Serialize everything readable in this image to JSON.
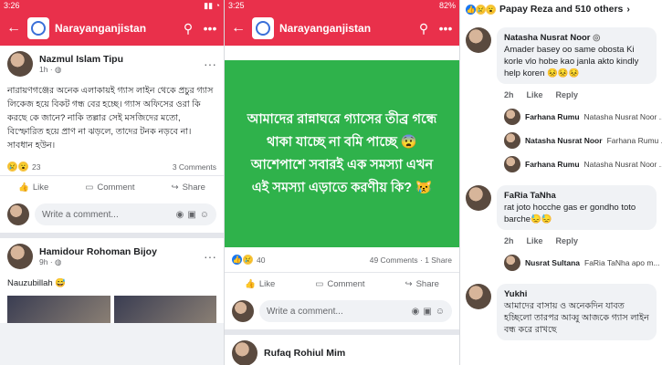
{
  "panel1": {
    "status": {
      "time": "3:26",
      "right": ""
    },
    "appbar": {
      "page_name": "Narayanganjistan"
    },
    "post1": {
      "author": "Nazmul Islam Tipu",
      "time": "1h ·",
      "text": "নারায়ণগঞ্জের অনেক এলাকায়ই গ্যাস লাইন থেকে প্রচুর গ্যাস লিকেজ হয়ে বিকট গন্ধ বের হচ্ছে। গ্যাস অফিসের ওরা কি করছে কে জানে? নাকি তল্লার সেই মসজিদের মতো, বিস্ফোরিত হয়ে প্রাণ না ঝড়লে, তাদের টনক নড়বে না। সাবধান হউন।",
      "reaction_count": "23",
      "comments": "3 Comments"
    },
    "actions": {
      "like": "Like",
      "comment": "Comment",
      "share": "Share"
    },
    "comment_placeholder": "Write a comment...",
    "post2": {
      "author": "Hamidour Rohoman Bijoy",
      "time": "9h ·",
      "text": "Nauzubillah 😅"
    }
  },
  "panel2": {
    "status": {
      "time": "3:25",
      "right": "82%"
    },
    "appbar": {
      "page_name": "Narayanganjistan"
    },
    "graphic_text": "আমাদের রান্নাঘরে গ্যাসের তীব্র গন্ধে থাকা যাচ্ছে না বমি পাচ্ছে 😨আশেপাশে সবারই এক সমস্যা এখন এই সমস্যা এড়াতে করণীয় কি? 😿",
    "reaction_count": "40",
    "comments": "49 Comments",
    "shares": "1 Share",
    "actions": {
      "like": "Like",
      "comment": "Comment",
      "share": "Share"
    },
    "comment_placeholder": "Write a comment...",
    "next_author": "Rufaq Rohiul Mim"
  },
  "panel3": {
    "reactors": "Papay Reza and 510 others",
    "comments": [
      {
        "name": "Natasha Nusrat Noor",
        "text": "Amader basey oo same obosta Ki korle vlo hobe kao janla akto kindly help koren 😣😣😣",
        "age": "2h",
        "like": "Like",
        "reply": "Reply"
      },
      {
        "name": "FaRia TaNha",
        "text": "rat joto hocche gas er gondho toto barche😓😓",
        "age": "2h",
        "like": "Like",
        "reply": "Reply"
      },
      {
        "name": "Yukhi",
        "text": "আমাদের বাসায় ও অনেকদিন যাবত হচ্ছিলো তারপর আব্বু আজকে গ্যাস লাইন বন্ধ করে রাখছে",
        "age": "",
        "like": "",
        "reply": ""
      }
    ],
    "replies1": [
      {
        "name": "Farhana Rumu",
        "text": "Natasha Nusrat Noor ..."
      },
      {
        "name": "Natasha Nusrat Noor",
        "text": "Farhana Rumu ..."
      },
      {
        "name": "Farhana Rumu",
        "text": "Natasha Nusrat Noor ..."
      }
    ],
    "replies2": [
      {
        "name": "Nusrat Sultana",
        "text": "FaRia TaNha apo m..."
      }
    ]
  }
}
